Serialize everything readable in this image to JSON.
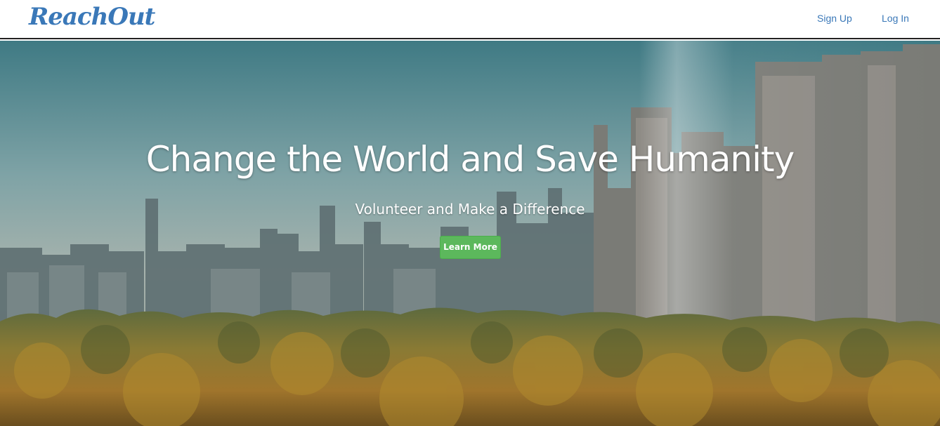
{
  "navbar": {
    "brand": "ReachOut",
    "links": [
      "Sign Up",
      "Log In"
    ]
  },
  "hero": {
    "title": "Change the World and Save Humanity",
    "subtitle": "Volunteer and Make a Difference",
    "button_label": "Learn More"
  },
  "colors": {
    "brand": "#3a78b8",
    "button": "#5cb85c"
  }
}
